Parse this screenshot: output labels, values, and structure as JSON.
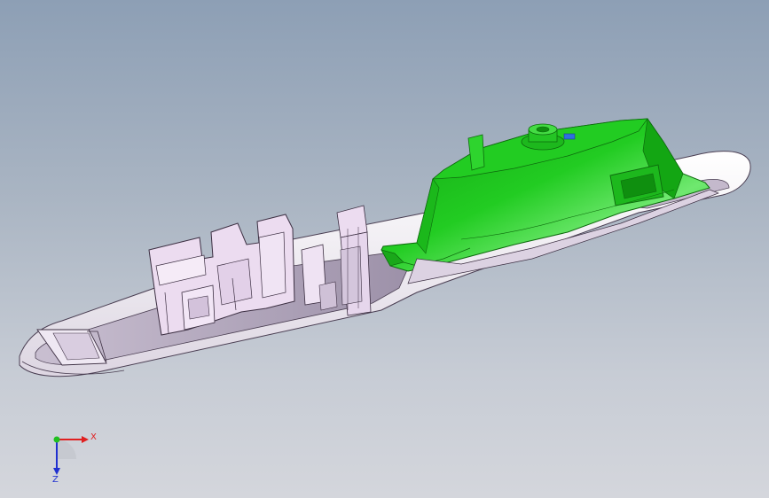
{
  "viewport": {
    "background_top": "#8d9fb5",
    "background_bottom": "#d4d6dc"
  },
  "model": {
    "colors": {
      "shell": "#f2eef4",
      "shell_inner": "#b8adc0",
      "bracket": "#ecdcf0",
      "bracket_edge": "#3c2f42",
      "cover": "#22cc22",
      "cover_light": "#6fe86f",
      "cover_dark": "#13a613",
      "cover_edge": "#0d6a0d",
      "marker": "#2f6fe0"
    }
  },
  "triad": {
    "x_label": "X",
    "z_label": "Z",
    "y_icon": "y-axis-dot-icon",
    "colors": {
      "x": "#e02020",
      "y": "#20c020",
      "z": "#2030d0"
    }
  }
}
